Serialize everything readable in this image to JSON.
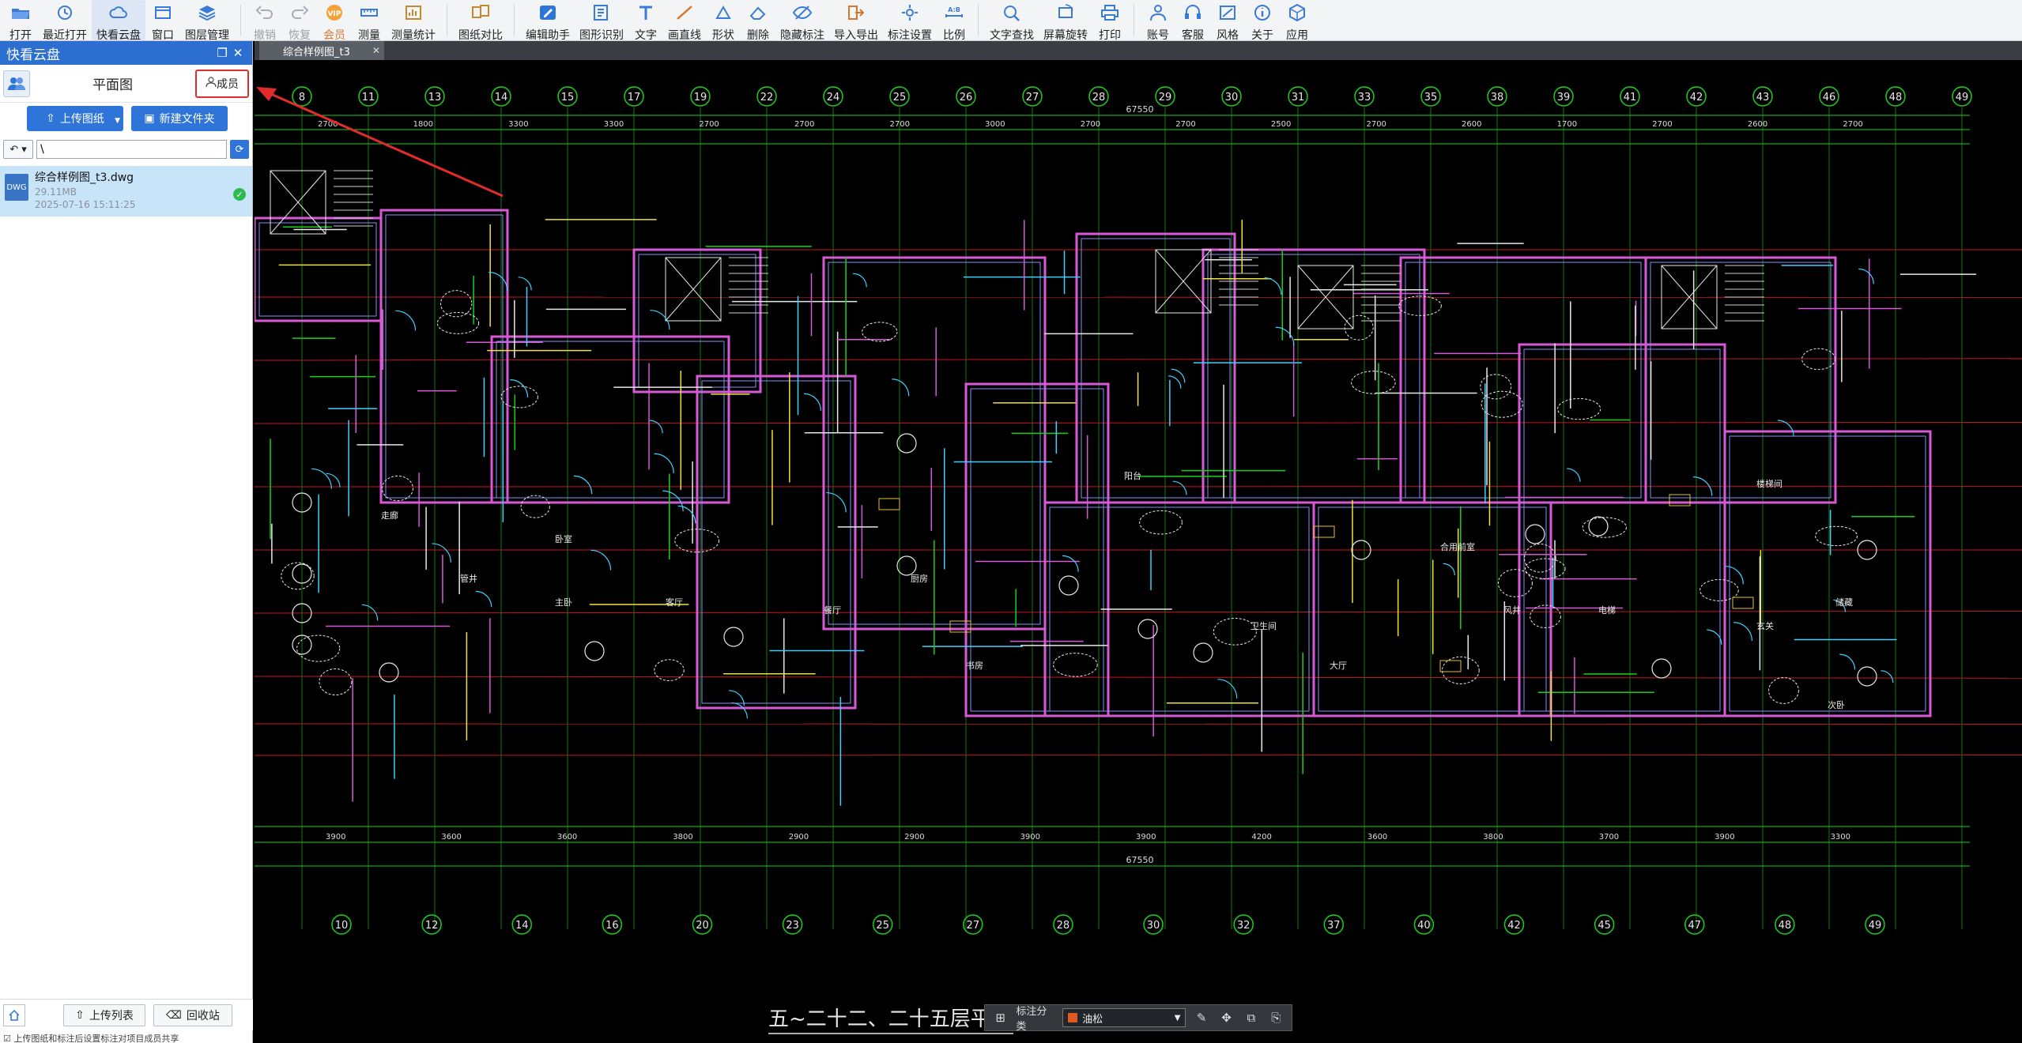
{
  "toolbar": {
    "buttons": [
      {
        "label": "打开",
        "icon": "folder-open-icon"
      },
      {
        "label": "最近打开",
        "icon": "history-icon"
      },
      {
        "label": "快看云盘",
        "icon": "cloud-icon"
      },
      {
        "label": "窗口",
        "icon": "window-icon"
      },
      {
        "label": "图层管理",
        "icon": "layers-icon"
      },
      {
        "label": "撤销",
        "icon": "undo-icon"
      },
      {
        "label": "恢复",
        "icon": "redo-icon"
      },
      {
        "label": "会员",
        "icon": "vip-icon"
      },
      {
        "label": "测量",
        "icon": "measure-icon"
      },
      {
        "label": "测量统计",
        "icon": "measure-stats-icon"
      },
      {
        "label": "图纸对比",
        "icon": "compare-icon"
      },
      {
        "label": "编辑助手",
        "icon": "edit-assistant-icon"
      },
      {
        "label": "图形识别",
        "icon": "shape-recognition-icon"
      },
      {
        "label": "文字",
        "icon": "text-icon"
      },
      {
        "label": "画直线",
        "icon": "line-icon"
      },
      {
        "label": "形状",
        "icon": "shape-icon"
      },
      {
        "label": "删除",
        "icon": "eraser-icon"
      },
      {
        "label": "隐藏标注",
        "icon": "hide-annotation-icon"
      },
      {
        "label": "导入导出",
        "icon": "import-export-icon"
      },
      {
        "label": "标注设置",
        "icon": "annotation-settings-icon"
      },
      {
        "label": "比例",
        "icon": "scale-icon"
      },
      {
        "label": "文字查找",
        "icon": "text-search-icon"
      },
      {
        "label": "屏幕旋转",
        "icon": "rotate-icon"
      },
      {
        "label": "打印",
        "icon": "print-icon"
      },
      {
        "label": "账号",
        "icon": "account-icon"
      },
      {
        "label": "客服",
        "icon": "support-icon"
      },
      {
        "label": "风格",
        "icon": "style-icon"
      },
      {
        "label": "关于",
        "icon": "about-icon"
      },
      {
        "label": "应用",
        "icon": "apps-icon"
      }
    ],
    "vip_text": "VIP",
    "ab_text": "A:B"
  },
  "panel": {
    "title": "快看云盘",
    "heading": "平面图",
    "member_label": "成员",
    "upload_label": "上传图纸",
    "new_folder_label": "新建文件夹",
    "path_value": "\\",
    "file": {
      "name": "综合样例图_t3.dwg",
      "size": "29.11MB",
      "date": "2025-07-16 15:11:25",
      "icon_text": "DWG"
    },
    "upload_list_label": "上传列表",
    "recycle_label": "回收站",
    "footer_note": "上传图纸和标注后设置标注对项目成员共享"
  },
  "tab": {
    "label": "综合样例图_t3"
  },
  "drawing": {
    "title": "五~二十二、二十五层平面图",
    "top_axes": [
      "8",
      "11",
      "13",
      "14",
      "15",
      "17",
      "19",
      "22",
      "24",
      "25",
      "26",
      "27",
      "28",
      "29",
      "30",
      "31",
      "33",
      "35",
      "38",
      "39",
      "41",
      "42",
      "43",
      "46",
      "48",
      "49"
    ],
    "bottom_axes": [
      "10",
      "12",
      "14",
      "16",
      "20",
      "23",
      "25",
      "27",
      "28",
      "30",
      "32",
      "37",
      "40",
      "42",
      "45",
      "47",
      "48",
      "49"
    ],
    "total_dim": "67550",
    "dims_row1": [
      "2700",
      "1800",
      "3300",
      "3300",
      "2700",
      "2700",
      "2700",
      "3000",
      "2700",
      "2700",
      "2500",
      "2700",
      "2600",
      "1700",
      "2700",
      "2600",
      "2700"
    ],
    "dims_row3": [
      "3900",
      "3600",
      "3600",
      "3800",
      "2900",
      "2900",
      "3900",
      "3900",
      "4200",
      "3600",
      "3800",
      "3700",
      "3900",
      "3300"
    ],
    "rooms": [
      "卧室",
      "主卧",
      "客厅",
      "餐厅",
      "厨房",
      "书房",
      "阳台",
      "卫生间",
      "大厅",
      "合用前室",
      "风井",
      "电梯",
      "玄关",
      "次卧",
      "走廊",
      "管井",
      "楼梯间",
      "储藏"
    ]
  },
  "anno_bar": {
    "label": "标注分类",
    "selected": "油松",
    "selected_color": "#e05a1f"
  }
}
